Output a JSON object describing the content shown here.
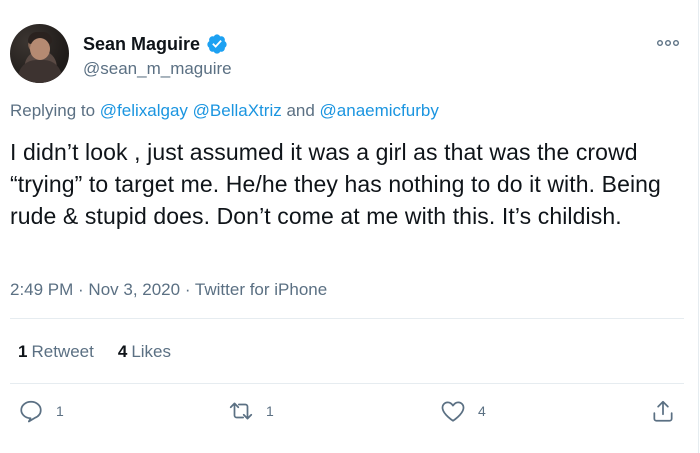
{
  "tweet": {
    "author_name": "Sean Maguire",
    "author_handle": "@sean_m_maguire",
    "reply_prefix": "Replying to ",
    "reply_users": [
      "@felixalgay",
      "@BellaXtriz",
      "@anaemicfurby"
    ],
    "reply_sep_1": " ",
    "reply_sep_2": " and ",
    "text": "I didn’t look , just assumed it was a girl as that was the crowd “trying” to target me. He/he they has nothing to do it with. Being rude & stupid does. Don’t come at me with this. It’s childish.",
    "time": "2:49 PM",
    "date": "Nov 3, 2020",
    "sep": " · ",
    "client": "Twitter for iPhone"
  },
  "stats": {
    "retweets_count": "1",
    "retweets_label": "Retweet",
    "likes_count": "4",
    "likes_label": "Likes"
  },
  "actions": {
    "reply_count": "1",
    "retweet_count": "1",
    "like_count": "4"
  },
  "colors": {
    "link": "#1b95e0",
    "muted": "#5b7083",
    "text": "#0f1419",
    "verified": "#1da1f2",
    "divider": "#e6ecf0"
  },
  "icons": [
    "verified-badge-icon",
    "more-icon",
    "reply-icon",
    "retweet-icon",
    "like-icon",
    "share-icon"
  ]
}
